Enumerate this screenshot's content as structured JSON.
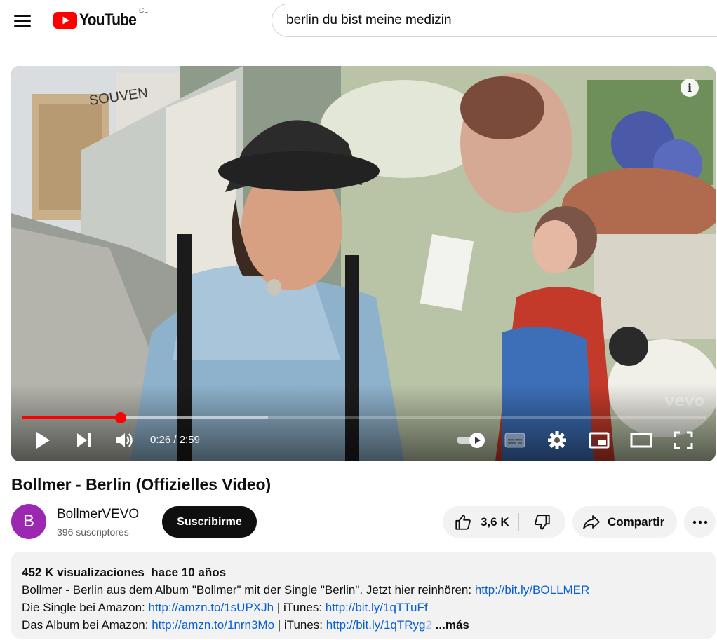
{
  "header": {
    "logo_text": "YouTube",
    "country_code": "CL",
    "search_value": "berlin du bist meine medizin"
  },
  "player": {
    "current_time": "0:26",
    "duration": "2:59",
    "time_separator": " / ",
    "played_fraction": 0.145,
    "buffered_fraction": 0.36,
    "watermark": "vevo",
    "info_glyph": "i"
  },
  "video": {
    "title": "Bollmer - Berlin (Offizielles Video)"
  },
  "channel": {
    "avatar_letter": "B",
    "avatar_color": "#9c27b0",
    "name": "BollmerVEVO",
    "subscribers": "396 suscriptores",
    "subscribe_label": "Suscribirme"
  },
  "actions": {
    "like_count": "3,6 K",
    "share_label": "Compartir"
  },
  "description": {
    "views": "452 K visualizaciones",
    "age": "hace 10 años",
    "line1_text": "Bollmer - Berlin aus dem Album \"Bollmer\" mit der Single \"Berlin\". Jetzt hier reinhören: ",
    "line1_link": "http://bit.ly/BOLLMER",
    "line2_text": "Die Single bei Amazon: ",
    "line2_link1": "http://amzn.to/1sUPXJh",
    "line2_sep": " | iTunes: ",
    "line2_link2": "http://bit.ly/1qTTuFf",
    "line3_text": "Das Album bei Amazon: ",
    "line3_link1": "http://amzn.to/1nrn3Mo",
    "line3_sep": " | iTunes: ",
    "line3_link2": "http://bit.ly/1qTRyg",
    "line3_link2_fade": "2",
    "more_label": "...más"
  },
  "colors": {
    "brand_red": "#ff0000",
    "link_blue": "#065fd4"
  }
}
